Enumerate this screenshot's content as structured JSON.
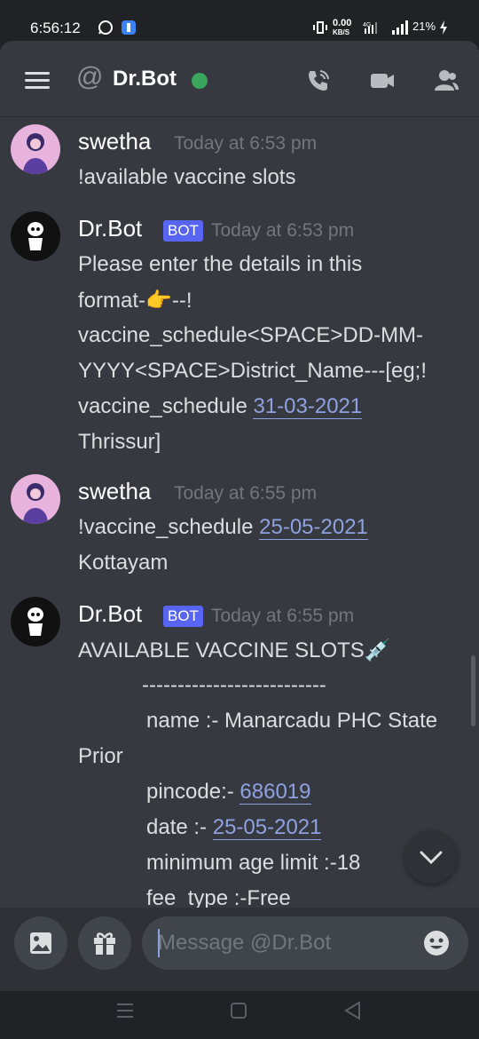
{
  "status_bar": {
    "time": "6:56:12",
    "net_speed": "0.00",
    "net_unit": "KB/S",
    "battery": "21%"
  },
  "header": {
    "title": "Dr.Bot",
    "at_symbol": "@",
    "icons": [
      "menu-icon",
      "call-icon",
      "video-icon",
      "members-icon"
    ]
  },
  "messages": [
    {
      "author": "swetha",
      "timestamp": "Today at 6:53 pm",
      "lines": [
        "!available vaccine slots"
      ]
    },
    {
      "author": "Dr.Bot",
      "badge": "BOT",
      "timestamp": "Today at 6:53 pm",
      "lines": [
        "Please enter the details in this",
        "format-👉--!",
        "vaccine_schedule<SPACE>DD-MM-",
        "YYYY<SPACE>District_Name---[eg;!",
        "Thrissur]"
      ],
      "line5_prefix": "vaccine_schedule ",
      "line5_link": "31-03-2021"
    },
    {
      "author": "swetha",
      "timestamp": "Today at 6:55 pm",
      "line1_prefix": "!vaccine_schedule ",
      "line1_link": "25-05-2021",
      "line2": "Kottayam"
    },
    {
      "author": "Dr.Bot",
      "badge": "BOT",
      "timestamp": "Today at 6:55 pm",
      "title": "AVAILABLE VACCINE SLOTS💉",
      "divider": "--------------------------",
      "name_line": "name :-  Manarcadu PHC State",
      "name_cont": "Prior",
      "pincode_label": "pincode:- ",
      "pincode": "686019",
      "date_label": "date :-  ",
      "date": "25-05-2021",
      "age_line": "minimum age limit :-18",
      "fee_line": "fee_type :-Free"
    }
  ],
  "composer": {
    "placeholder": "Message @Dr.Bot"
  },
  "colors": {
    "background": "#36393f",
    "accent": "#5865f2",
    "online": "#3ba55d",
    "link": "#8ea1e1"
  }
}
